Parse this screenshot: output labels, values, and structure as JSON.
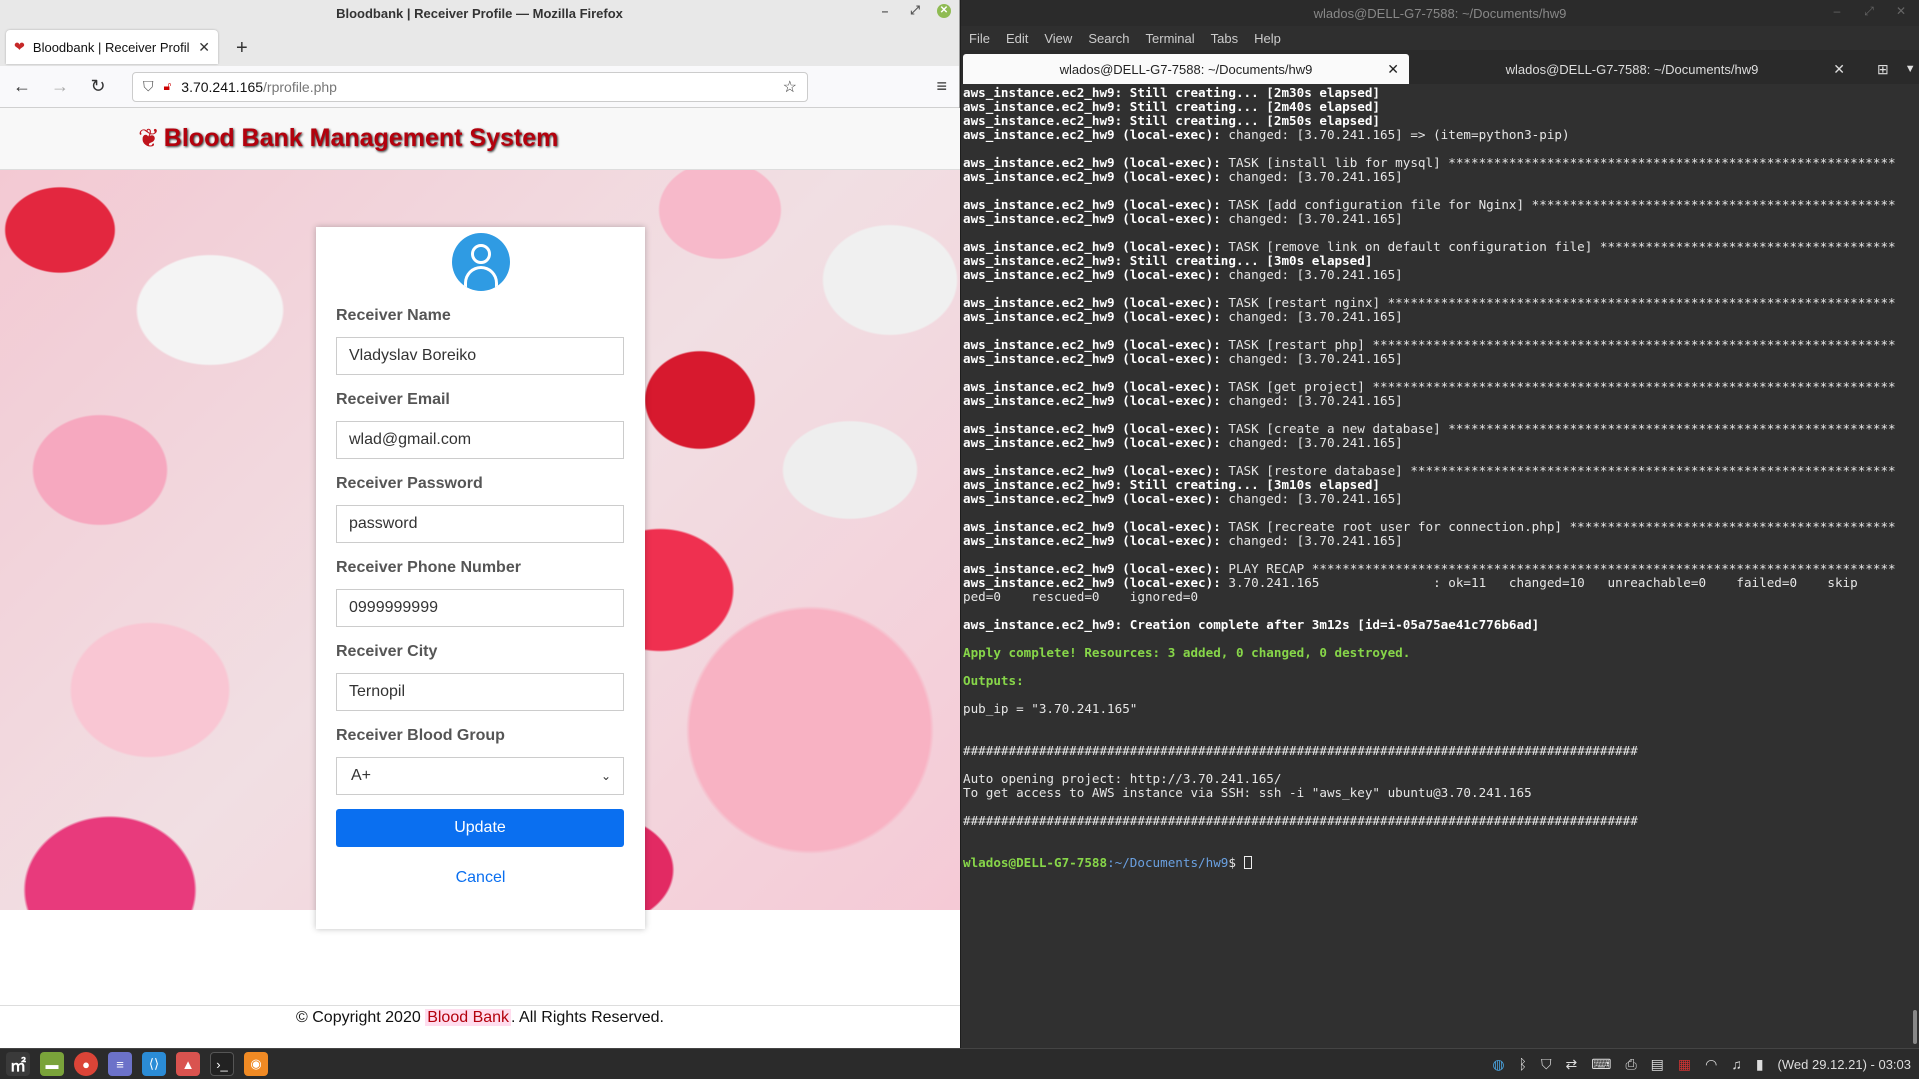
{
  "firefox": {
    "window_title": "Bloodbank | Receiver Profile — Mozilla Firefox",
    "tab_label": "Bloodbank | Receiver Profile",
    "url_host": "3.70.241.165",
    "url_path": "/rprofile.php"
  },
  "site": {
    "title": "Blood Bank Management System",
    "form": {
      "name_label": "Receiver Name",
      "name_value": "Vladyslav Boreiko",
      "email_label": "Receiver Email",
      "email_value": "wlad@gmail.com",
      "password_label": "Receiver Password",
      "password_value": "password",
      "phone_label": "Receiver Phone Number",
      "phone_value": "0999999999",
      "city_label": "Receiver City",
      "city_value": "Ternopil",
      "blood_label": "Receiver Blood Group",
      "blood_value": "A+",
      "update_label": "Update",
      "cancel_label": "Cancel"
    },
    "footer": {
      "prefix": "© Copyright 2020 ",
      "brand": "Blood Bank",
      "suffix": ". All Rights Reserved."
    }
  },
  "terminal": {
    "window_title": "wlados@DELL-G7-7588: ~/Documents/hw9",
    "menu": [
      "File",
      "Edit",
      "View",
      "Search",
      "Terminal",
      "Tabs",
      "Help"
    ],
    "tabs": [
      "wlados@DELL-G7-7588: ~/Documents/hw9",
      "wlados@DELL-G7-7588: ~/Documents/hw9"
    ],
    "lines": [
      {
        "b": "aws_instance.ec2_hw9: Still creating... [2m30s elapsed]",
        "t": ""
      },
      {
        "b": "aws_instance.ec2_hw9: Still creating... [2m40s elapsed]",
        "t": ""
      },
      {
        "b": "aws_instance.ec2_hw9: Still creating... [2m50s elapsed]",
        "t": ""
      },
      {
        "b": "aws_instance.ec2_hw9 (local-exec):",
        "t": " changed: [3.70.241.165] => (item=python3-pip)"
      },
      {
        "b": "",
        "t": ""
      },
      {
        "b": "aws_instance.ec2_hw9 (local-exec):",
        "t": " TASK [install lib for mysql] ***********************************************************"
      },
      {
        "b": "aws_instance.ec2_hw9 (local-exec):",
        "t": " changed: [3.70.241.165]"
      },
      {
        "b": "",
        "t": ""
      },
      {
        "b": "aws_instance.ec2_hw9 (local-exec):",
        "t": " TASK [add configuration file for Nginx] ************************************************"
      },
      {
        "b": "aws_instance.ec2_hw9 (local-exec):",
        "t": " changed: [3.70.241.165]"
      },
      {
        "b": "",
        "t": ""
      },
      {
        "b": "aws_instance.ec2_hw9 (local-exec):",
        "t": " TASK [remove link on default configuration file] ***************************************"
      },
      {
        "b": "aws_instance.ec2_hw9: Still creating... [3m0s elapsed]",
        "t": ""
      },
      {
        "b": "aws_instance.ec2_hw9 (local-exec):",
        "t": " changed: [3.70.241.165]"
      },
      {
        "b": "",
        "t": ""
      },
      {
        "b": "aws_instance.ec2_hw9 (local-exec):",
        "t": " TASK [restart nginx] *******************************************************************"
      },
      {
        "b": "aws_instance.ec2_hw9 (local-exec):",
        "t": " changed: [3.70.241.165]"
      },
      {
        "b": "",
        "t": ""
      },
      {
        "b": "aws_instance.ec2_hw9 (local-exec):",
        "t": " TASK [restart php] *********************************************************************"
      },
      {
        "b": "aws_instance.ec2_hw9 (local-exec):",
        "t": " changed: [3.70.241.165]"
      },
      {
        "b": "",
        "t": ""
      },
      {
        "b": "aws_instance.ec2_hw9 (local-exec):",
        "t": " TASK [get project] *********************************************************************"
      },
      {
        "b": "aws_instance.ec2_hw9 (local-exec):",
        "t": " changed: [3.70.241.165]"
      },
      {
        "b": "",
        "t": ""
      },
      {
        "b": "aws_instance.ec2_hw9 (local-exec):",
        "t": " TASK [create a new database] ***********************************************************"
      },
      {
        "b": "aws_instance.ec2_hw9 (local-exec):",
        "t": " changed: [3.70.241.165]"
      },
      {
        "b": "",
        "t": ""
      },
      {
        "b": "aws_instance.ec2_hw9 (local-exec):",
        "t": " TASK [restore database] ****************************************************************"
      },
      {
        "b": "aws_instance.ec2_hw9: Still creating... [3m10s elapsed]",
        "t": ""
      },
      {
        "b": "aws_instance.ec2_hw9 (local-exec):",
        "t": " changed: [3.70.241.165]"
      },
      {
        "b": "",
        "t": ""
      },
      {
        "b": "aws_instance.ec2_hw9 (local-exec):",
        "t": " TASK [recreate root user for connection.php] *******************************************"
      },
      {
        "b": "aws_instance.ec2_hw9 (local-exec):",
        "t": " changed: [3.70.241.165]"
      },
      {
        "b": "",
        "t": ""
      },
      {
        "b": "aws_instance.ec2_hw9 (local-exec):",
        "t": " PLAY RECAP *****************************************************************************"
      },
      {
        "b": "aws_instance.ec2_hw9 (local-exec):",
        "t": " 3.70.241.165               : ok=11   changed=10   unreachable=0    failed=0    skip"
      },
      {
        "b": "",
        "t": "ped=0    rescued=0    ignored=0"
      },
      {
        "b": "",
        "t": ""
      },
      {
        "b": "aws_instance.ec2_hw9: Creation complete after 3m12s [id=i-05a75ae41c776b6ad]",
        "t": ""
      },
      {
        "b": "",
        "t": ""
      },
      {
        "g": "Apply complete! Resources: 3 added, 0 changed, 0 destroyed."
      },
      {
        "b": "",
        "t": ""
      },
      {
        "g": "Outputs:"
      },
      {
        "b": "",
        "t": ""
      },
      {
        "b": "",
        "t": "pub_ip = \"3.70.241.165\""
      },
      {
        "b": "",
        "t": ""
      },
      {
        "b": "",
        "t": ""
      },
      {
        "b": "",
        "t": "#########################################################################################"
      },
      {
        "b": "",
        "t": ""
      },
      {
        "b": "",
        "t": "Auto opening project: http://3.70.241.165/"
      },
      {
        "b": "",
        "t": "To get access to AWS instance via SSH: ssh -i \"aws_key\" ubuntu@3.70.241.165"
      },
      {
        "b": "",
        "t": ""
      },
      {
        "b": "",
        "t": "#########################################################################################"
      },
      {
        "b": "",
        "t": ""
      },
      {
        "b": "",
        "t": ""
      }
    ],
    "prompt_user": "wlados@DELL-G7-7588",
    "prompt_path": ":~/Documents/hw9",
    "prompt_sym": "$ "
  },
  "taskbar": {
    "clock": "(Wed 29.12.21) - 03:03"
  },
  "colors": {
    "accent": "#0a6ff0",
    "brand_red": "#b3010d",
    "terminal_green": "#87d649"
  }
}
